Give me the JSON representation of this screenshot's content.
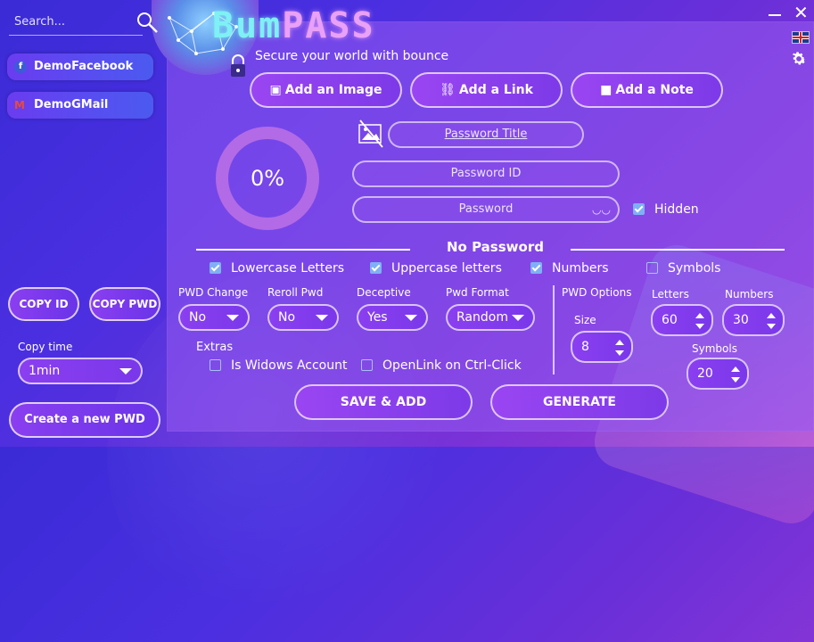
{
  "brand": {
    "logo_a": "Bum",
    "logo_b": "PASS",
    "tagline": "Secure your world with bounce"
  },
  "sidebar": {
    "search_placeholder": "Search...",
    "items": [
      {
        "label": "DemoFacebook",
        "icon": "facebook-icon"
      },
      {
        "label": "DemoGMail",
        "icon": "gmail-icon"
      }
    ],
    "copy_id": "COPY ID",
    "copy_pwd": "COPY PWD",
    "copy_time_label": "Copy time",
    "copy_time_value": "1min",
    "create_label": "Create a new PWD"
  },
  "actions": {
    "add_image": "Add an Image",
    "add_link": "Add a Link",
    "add_note": "Add a Note"
  },
  "form": {
    "progress": "0%",
    "title_placeholder": "Password Title",
    "id_placeholder": "Password ID",
    "password_placeholder": "Password",
    "hidden_label": "Hidden"
  },
  "generator": {
    "heading": "No Password",
    "checks": [
      {
        "label": "Lowercase Letters",
        "checked": true
      },
      {
        "label": "Uppercase letters",
        "checked": true
      },
      {
        "label": "Numbers",
        "checked": true
      },
      {
        "label": "Symbols",
        "checked": false
      }
    ],
    "selects": [
      {
        "label": "PWD Change",
        "value": "No"
      },
      {
        "label": "Reroll Pwd",
        "value": "No"
      },
      {
        "label": "Deceptive",
        "value": "Yes"
      },
      {
        "label": "Pwd Format",
        "value": "Random"
      }
    ],
    "extras_label": "Extras",
    "extras": [
      {
        "label": "Is Widows Account",
        "checked": false
      },
      {
        "label": "OpenLink on Ctrl-Click",
        "checked": false
      }
    ],
    "pwd_options_label": "PWD Options",
    "size_label": "Size",
    "size_value": "8",
    "letters_label": "Letters",
    "letters_value": "60",
    "numbers_label": "Numbers",
    "numbers_value": "30",
    "symbols_label": "Symbols",
    "symbols_value": "20",
    "save_label": "SAVE & ADD",
    "generate_label": "GENERATE"
  }
}
